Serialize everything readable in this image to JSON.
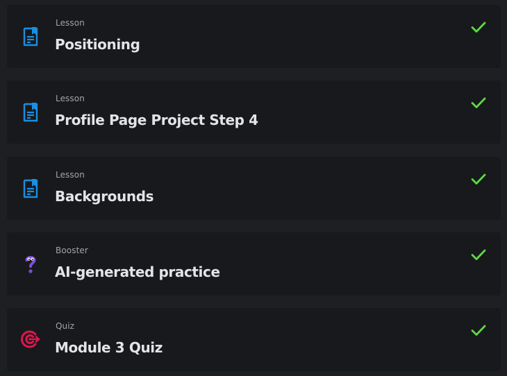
{
  "items": [
    {
      "kind": "Lesson",
      "title": "Positioning",
      "icon": "lesson-doc-icon",
      "completed": true
    },
    {
      "kind": "Lesson",
      "title": "Profile Page Project Step 4",
      "icon": "lesson-doc-icon",
      "completed": true
    },
    {
      "kind": "Lesson",
      "title": "Backgrounds",
      "icon": "lesson-doc-icon",
      "completed": true
    },
    {
      "kind": "Booster",
      "title": "AI-generated practice",
      "icon": "question-mark-icon",
      "completed": true
    },
    {
      "kind": "Quiz",
      "title": "Module 3 Quiz",
      "icon": "target-icon",
      "completed": true
    }
  ],
  "colors": {
    "lesson_icon": "#1a8fe3",
    "booster_icon": "#7b4fd6",
    "quiz_icon": "#e0154f",
    "check": "#5ddb43"
  }
}
